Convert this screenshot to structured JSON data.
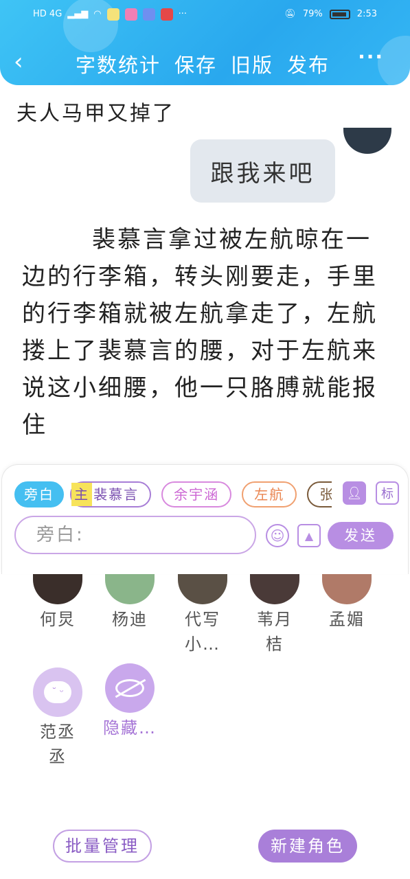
{
  "status_bar": {
    "network": "HD 4G",
    "battery": "79%",
    "time": "2:53"
  },
  "nav": {
    "back_icon": "chevron-left-icon",
    "items": [
      "字数统计",
      "保存",
      "旧版",
      "发布"
    ],
    "more_label": "···"
  },
  "chat": {
    "speaker_line": "夫人马甲又掉了",
    "bubble_text": "跟我来吧",
    "narration": "裴慕言拿过被左航晾在一边的行李箱，转头刚要走，手里的行李箱就被左航拿走了，左航搂上了裴慕言的腰，对于左航来说这小细腰，他一只胳膊就能报住"
  },
  "composer": {
    "chips": [
      {
        "label": "旁白"
      },
      {
        "tag": "主",
        "label": "裴慕言"
      },
      {
        "label": "余宇涵"
      },
      {
        "label": "左航"
      },
      {
        "label": "张"
      }
    ],
    "mark_label": "标",
    "placeholder": "旁白:",
    "send_label": "发送"
  },
  "roles": [
    {
      "name": "何炅"
    },
    {
      "name": "杨迪"
    },
    {
      "name": "代写小…"
    },
    {
      "name": "苇月桔"
    },
    {
      "name": "孟媚"
    },
    {
      "name": "范丞丞"
    },
    {
      "name": "隐藏…"
    }
  ],
  "footer": {
    "batch_label": "批量管理",
    "new_label": "新建角色"
  },
  "colors": {
    "header": "#29a8ee",
    "accent_purple": "#b88ee3",
    "narration_chip": "#45bff1"
  }
}
